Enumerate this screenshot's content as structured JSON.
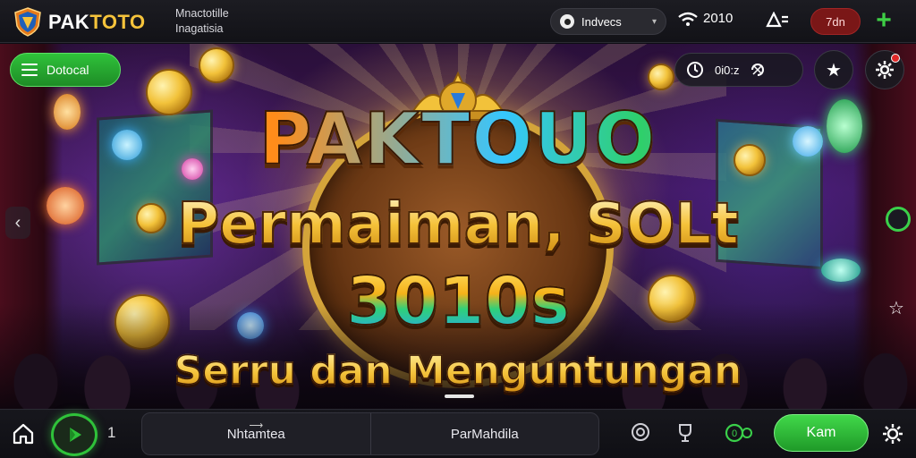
{
  "header": {
    "logo_text_main": "PAK",
    "logo_text_accent": "TOTO",
    "tagline_line1": "Mnactotille",
    "tagline_line2": "Inagatisia",
    "language_label": "Indvecs",
    "signal_value": "2010",
    "red_pill_label": "7dn",
    "plus_label": "+"
  },
  "hero": {
    "menu_label": "Dotocal",
    "stat_value": "0i0:z",
    "title_line1": "PAKTOUO",
    "title_line2": "Permaiman, SOLt",
    "title_line3": "3010s",
    "title_line4": "Serru  dan  Menguntungan"
  },
  "bottom": {
    "page_number": "1",
    "segment_left": "Nhtamtea",
    "segment_right": "ParMahdila",
    "cta_label": "Kam",
    "stat_badge": "0"
  },
  "colors": {
    "brand_green": "#2fc23a",
    "brand_gold": "#f5c33b",
    "alert_red": "#7a1717",
    "background": "#121217"
  },
  "icons": {
    "logo": "shield-logo-icon",
    "language": "globe-icon",
    "signal": "wifi-signal-icon",
    "menu": "hamburger-icon",
    "timer": "clock-icon",
    "star": "star-icon",
    "settings": "gear-icon",
    "home": "home-icon",
    "play": "play-icon"
  }
}
